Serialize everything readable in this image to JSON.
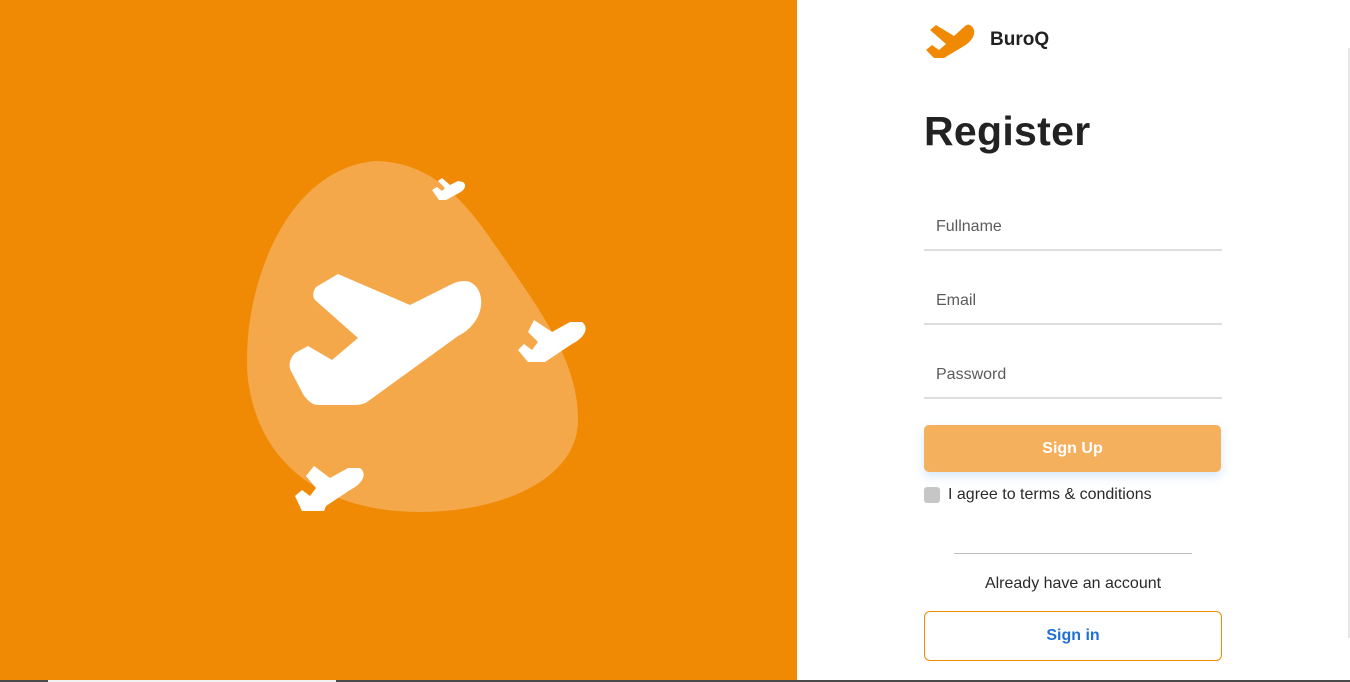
{
  "brand": {
    "name": "BuroQ",
    "logo_icon": "airplane-icon"
  },
  "form": {
    "title": "Register",
    "fullname_placeholder": "Fullname",
    "email_placeholder": "Email",
    "password_placeholder": "Password",
    "signup_label": "Sign Up",
    "terms_label": "I agree to terms & conditions",
    "already_text": "Already have an account",
    "signin_label": "Sign in"
  },
  "colors": {
    "brand_orange": "#f08a05",
    "signup_button": "#f4b05c",
    "signin_text": "#1f6fd6"
  }
}
